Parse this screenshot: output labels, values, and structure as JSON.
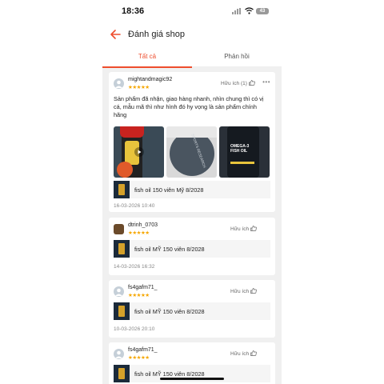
{
  "status_bar": {
    "time": "18:36",
    "battery": "43"
  },
  "header": {
    "title": "Đánh giá shop"
  },
  "tabs": [
    {
      "label": "Tất cả",
      "active": true
    },
    {
      "label": "Phản hồi",
      "active": false
    }
  ],
  "icons": {
    "back": "arrow-left-icon",
    "thumbs_up": "thumbs-up-icon",
    "more": "ellipsis-icon",
    "star": "star-icon"
  },
  "colors": {
    "accent": "#ee4d2d",
    "star": "#f6a700"
  },
  "reviews": [
    {
      "username": "mightandmagic92",
      "stars": "★★★★★",
      "rating": 5,
      "helpful": "Hữu ích (1)",
      "text": "Sản phẩm đã nhận, giao hàng nhanh, nhìn chung thì có vị cá, mẫu mã thì như hình đó hy vọng là sản phẩm chính hãng",
      "photo_labels": [
        "",
        "SPORTS RESEARCH",
        "OMEGA-3 FISH OIL"
      ],
      "product": "fish oil  150 viên Mỹ  8/2028",
      "date": "16-03-2026 10:40"
    },
    {
      "username": "dtrinh_0703",
      "stars": "★★★★★",
      "rating": 5,
      "helpful": "Hữu ích",
      "product": "fish oil MỸ 150 viên 8/2028",
      "date": "14-03-2026 16:32"
    },
    {
      "username": "fs4gafm71_",
      "stars": "★★★★★",
      "rating": 5,
      "helpful": "Hữu ích",
      "product": "fish oil MỸ 150 viên 8/2028",
      "date": "10-03-2026 20:10"
    },
    {
      "username": "fs4gafm71_",
      "stars": "★★★★★",
      "rating": 5,
      "helpful": "Hữu ích",
      "product": "fish oil MỸ 150 viên 8/2028"
    }
  ]
}
